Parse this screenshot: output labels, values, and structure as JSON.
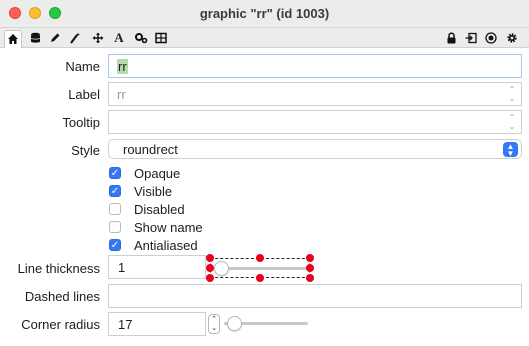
{
  "window": {
    "title": "graphic \"rr\" (id 1003)"
  },
  "toolbar": {
    "left_icons": [
      "home-icon",
      "database-icon",
      "pen-icon",
      "magic-wand-icon",
      "move-icon",
      "text-icon",
      "gears-icon",
      "layout-icon"
    ],
    "right_icons": [
      "lock-icon",
      "export-icon",
      "target-icon",
      "gear-icon"
    ],
    "active": "home-icon"
  },
  "form": {
    "name": {
      "label": "Name",
      "value": "rr"
    },
    "label_field": {
      "label": "Label",
      "value": "rr"
    },
    "tooltip": {
      "label": "Tooltip",
      "value": ""
    },
    "style": {
      "label": "Style",
      "value": "roundrect"
    },
    "checkboxes": [
      {
        "label": "Opaque",
        "checked": true
      },
      {
        "label": "Visible",
        "checked": true
      },
      {
        "label": "Disabled",
        "checked": false
      },
      {
        "label": "Show name",
        "checked": false
      },
      {
        "label": "Antialiased",
        "checked": true
      }
    ],
    "line_thickness": {
      "label": "Line thickness",
      "value": "1"
    },
    "dashed_lines": {
      "label": "Dashed lines",
      "value": ""
    },
    "corner_radius": {
      "label": "Corner radius",
      "value": "17"
    }
  },
  "colors": {
    "accent": "#3478f6",
    "handle": "#e8001c"
  }
}
